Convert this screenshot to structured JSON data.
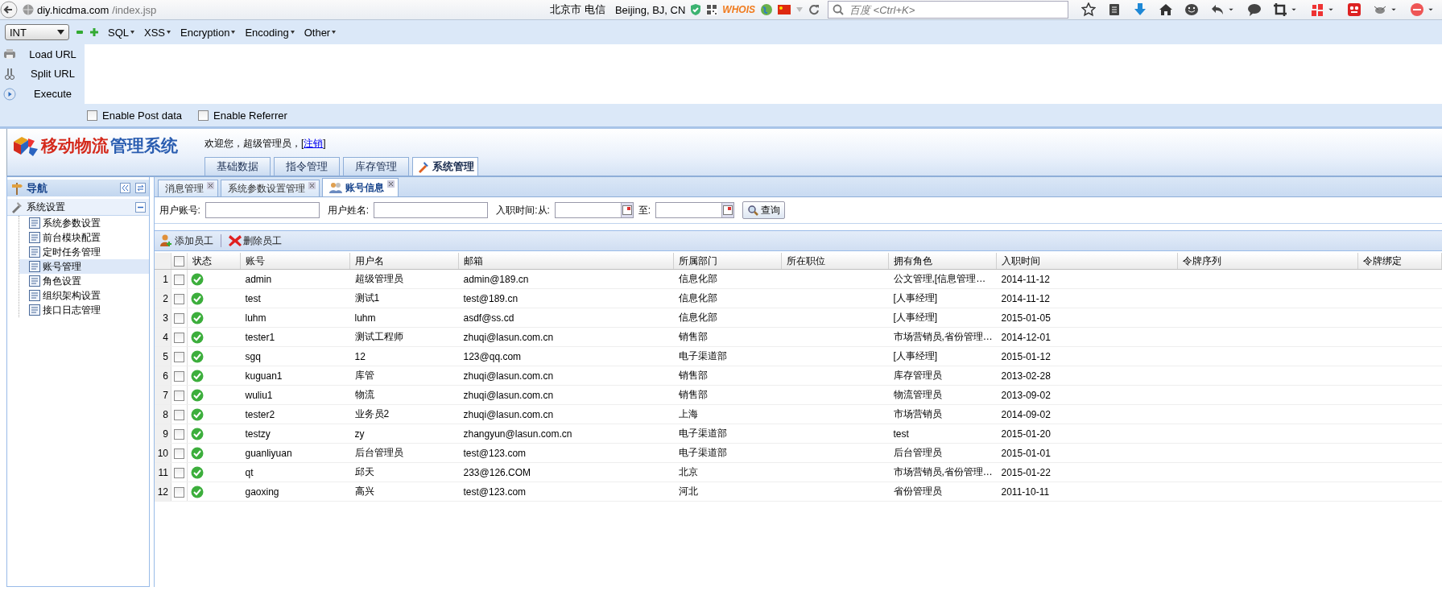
{
  "browser": {
    "url_host": "diy.hicdma.com",
    "url_path": "/index.jsp",
    "location": "北京市 电信",
    "geo": "Beijing, BJ, CN",
    "whois": "WHOIS",
    "search": {
      "placeholder": "百度 <Ctrl+K>"
    }
  },
  "hackbar": {
    "select": "INT",
    "menus": [
      "SQL",
      "XSS",
      "Encryption",
      "Encoding",
      "Other"
    ],
    "actions": [
      {
        "label": "Load URL",
        "kind": "load"
      },
      {
        "label": "Split URL",
        "kind": "split"
      },
      {
        "label": "Execute",
        "kind": "execute"
      }
    ],
    "options": [
      {
        "label": "Enable Post data",
        "checked": false
      },
      {
        "label": "Enable Referrer",
        "checked": false
      }
    ]
  },
  "app": {
    "logo_red": "移动物流",
    "logo_blue": "管理系统",
    "welcome": "欢迎您，超级管理员，[",
    "logout": "注销",
    "welcome_end": "]",
    "top_tabs": [
      {
        "label": "基础数据",
        "selected": false
      },
      {
        "label": "指令管理",
        "selected": false
      },
      {
        "label": "库存管理",
        "selected": false
      },
      {
        "label": "系统管理",
        "selected": true
      }
    ],
    "nav": {
      "title": "导航",
      "section": "系统设置",
      "items": [
        {
          "label": "系统参数设置",
          "selected": false
        },
        {
          "label": "前台模块配置",
          "selected": false
        },
        {
          "label": "定时任务管理",
          "selected": false
        },
        {
          "label": "账号管理",
          "selected": true
        },
        {
          "label": "角色设置",
          "selected": false
        },
        {
          "label": "组织架构设置",
          "selected": false
        },
        {
          "label": "接口日志管理",
          "selected": false
        }
      ]
    },
    "tabs": [
      {
        "label": "消息管理",
        "selected": false
      },
      {
        "label": "系统参数设置管理",
        "selected": false
      },
      {
        "label": "账号信息",
        "selected": true
      }
    ],
    "search": {
      "account_label": "用户账号:",
      "name_label": "用户姓名:",
      "from_label": "入职时间:从:",
      "to_label": "至:",
      "button": "查询"
    },
    "toolbar": [
      {
        "label": "添加员工",
        "kind": "add"
      },
      {
        "label": "删除员工",
        "kind": "delete"
      }
    ],
    "table": {
      "select_all_checked": false,
      "columns": [
        "状态",
        "账号",
        "用户名",
        "邮箱",
        "所属部门",
        "所在职位",
        "拥有角色",
        "入职时间",
        "令牌序列",
        "令牌绑定"
      ],
      "rows": [
        {
          "num": "1",
          "checked": false,
          "enabled": true,
          "account": "admin",
          "username": "超级管理员",
          "email": "admin@189.cn",
          "department": "信息化部",
          "role": "公文管理,[信息管理…",
          "hire_date": "2014-11-12"
        },
        {
          "num": "2",
          "checked": false,
          "enabled": true,
          "account": "test",
          "username": "测试1",
          "email": "test@189.cn",
          "department": "信息化部",
          "role": "[人事经理]",
          "hire_date": "2014-11-12"
        },
        {
          "num": "3",
          "checked": false,
          "enabled": true,
          "account": "luhm",
          "username": "luhm",
          "email": "asdf@ss.cd",
          "department": "信息化部",
          "role": "[人事经理]",
          "hire_date": "2015-01-05"
        },
        {
          "num": "4",
          "checked": false,
          "enabled": true,
          "account": "tester1",
          "username": "测试工程师",
          "email": "zhuqi@lasun.com.cn",
          "department": "销售部",
          "role": "市场营销员,省份管理…",
          "hire_date": "2014-12-01"
        },
        {
          "num": "5",
          "checked": false,
          "enabled": true,
          "account": "sgq",
          "username": "12",
          "email": "123@qq.com",
          "department": "电子渠道部",
          "role": "[人事经理]",
          "hire_date": "2015-01-12"
        },
        {
          "num": "6",
          "checked": false,
          "enabled": true,
          "account": "kuguan1",
          "username": "库管",
          "email": "zhuqi@lasun.com.cn",
          "department": "销售部",
          "role": "库存管理员",
          "hire_date": "2013-02-28"
        },
        {
          "num": "7",
          "checked": false,
          "enabled": true,
          "account": "wuliu1",
          "username": "物流",
          "email": "zhuqi@lasun.com.cn",
          "department": "销售部",
          "role": "物流管理员",
          "hire_date": "2013-09-02"
        },
        {
          "num": "8",
          "checked": false,
          "enabled": true,
          "account": "tester2",
          "username": "业务员2",
          "email": "zhuqi@lasun.com.cn",
          "department": "上海",
          "role": "市场营销员",
          "hire_date": "2014-09-02"
        },
        {
          "num": "9",
          "checked": false,
          "enabled": true,
          "account": "testzy",
          "username": "zy",
          "email": "zhangyun@lasun.com.cn",
          "department": "电子渠道部",
          "role": "test",
          "hire_date": "2015-01-20"
        },
        {
          "num": "10",
          "checked": false,
          "enabled": true,
          "account": "guanliyuan",
          "username": "后台管理员",
          "email": "test@123.com",
          "department": "电子渠道部",
          "role": "后台管理员",
          "hire_date": "2015-01-01"
        },
        {
          "num": "11",
          "checked": false,
          "enabled": true,
          "account": "qt",
          "username": "邱天",
          "email": "233@126.COM",
          "department": "北京",
          "role": "市场营销员,省份管理…",
          "hire_date": "2015-01-22"
        },
        {
          "num": "12",
          "checked": false,
          "enabled": true,
          "account": "gaoxing",
          "username": "高兴",
          "email": "test@123.com",
          "department": "河北",
          "role": "省份管理员",
          "hire_date": "2011-10-11"
        }
      ]
    }
  }
}
